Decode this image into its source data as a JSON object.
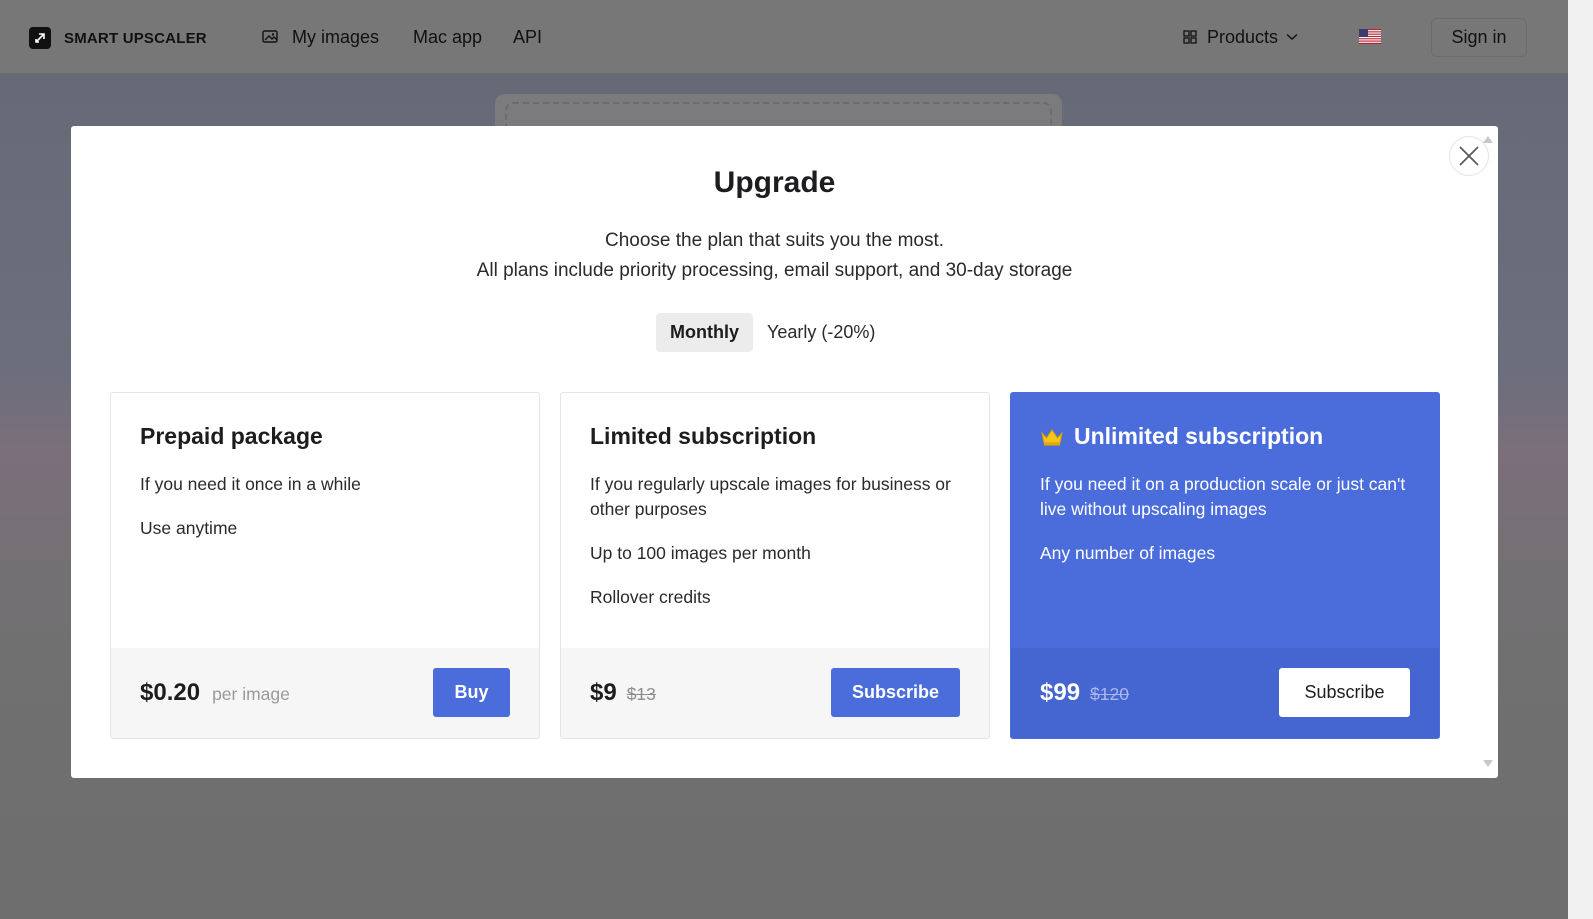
{
  "header": {
    "logo_text": "SMART UPSCALER",
    "nav": {
      "my_images": "My images",
      "mac_app": "Mac app",
      "api": "API"
    },
    "products_label": "Products",
    "sign_in": "Sign in"
  },
  "modal": {
    "title": "Upgrade",
    "subtitle_line1": "Choose the plan that suits you the most.",
    "subtitle_line2": "All plans include priority processing, email support, and 30-day storage",
    "billing_toggle": {
      "monthly": "Monthly",
      "yearly": "Yearly (-20%)",
      "selected": "Monthly"
    },
    "plans": [
      {
        "title": "Prepaid package",
        "description": "If you need it once in a while",
        "features": [
          "Use anytime"
        ],
        "price": "$0.20",
        "price_suffix": "per image",
        "button": "Buy"
      },
      {
        "title": "Limited subscription",
        "description": "If you regularly upscale images for business or other purposes",
        "features": [
          "Up to 100 images per month",
          "Rollover credits"
        ],
        "price": "$9",
        "old_price": "$13",
        "button": "Subscribe"
      },
      {
        "title": "Unlimited subscription",
        "description": "If you need it on a production scale or just can't live without upscaling images",
        "features": [
          "Any number of images"
        ],
        "price": "$99",
        "old_price": "$120",
        "button": "Subscribe",
        "highlighted": true
      }
    ]
  },
  "colors": {
    "accent": "#4a6ddb",
    "overlay": "#6e6e6e",
    "crown": "#f5c518"
  }
}
